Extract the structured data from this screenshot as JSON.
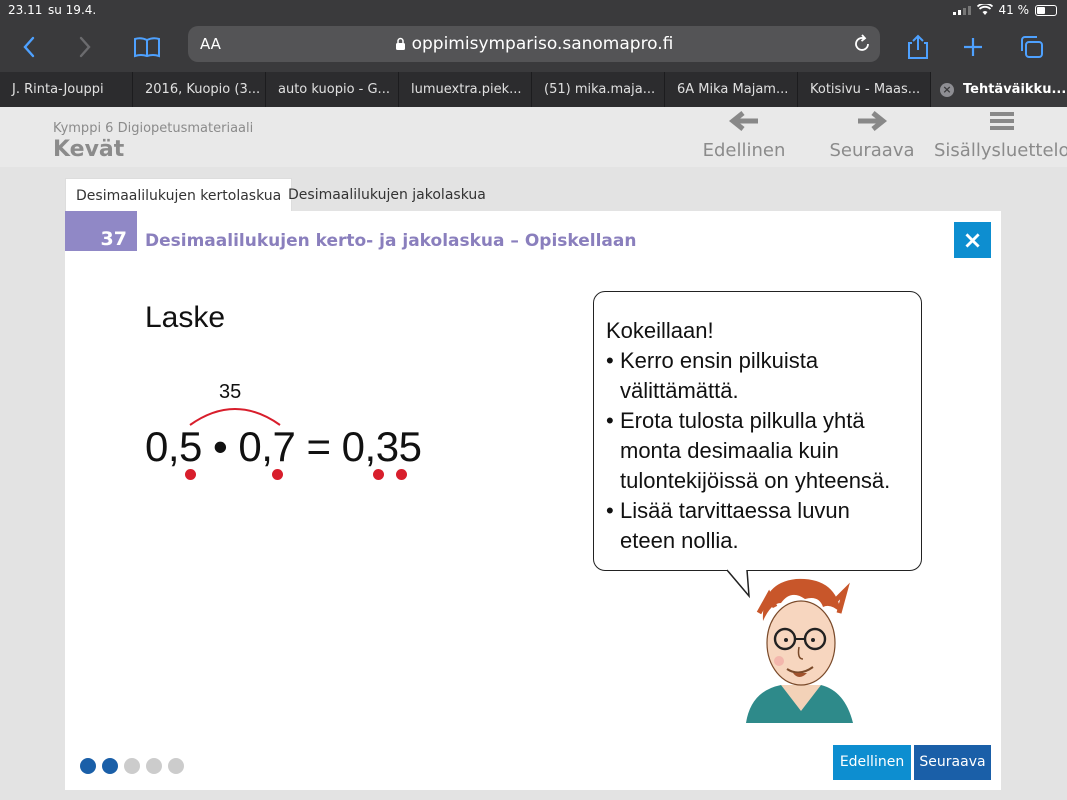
{
  "status": {
    "time": "23.11",
    "date": "su 19.4.",
    "battery": "41 %"
  },
  "browser": {
    "text_size_label": "AA",
    "url": "oppimisympariso.sanomapro.fi",
    "tabs": [
      {
        "label": "J. Rinta-Jouppi"
      },
      {
        "label": "2016, Kuopio (3..."
      },
      {
        "label": "auto kuopio - G..."
      },
      {
        "label": "lumuextra.piek..."
      },
      {
        "label": "(51) mika.maja..."
      },
      {
        "label": "6A Mika Majam..."
      },
      {
        "label": "Kotisivu - Maas..."
      },
      {
        "label": "Tehtäväikku..."
      }
    ]
  },
  "page": {
    "subtitle": "Kymppi 6 Digiopetusmateriaali",
    "title": "Kevät",
    "nav": {
      "prev": "Edellinen",
      "next": "Seuraava",
      "toc": "Sisällysluettelo"
    }
  },
  "content_tabs": [
    "Desimaalilukujen kertolaskua",
    "Desimaalilukujen jakolaskua"
  ],
  "card": {
    "number": "37",
    "title": "Desimaalilukujen kerto- ja jakolaskua – Opiskellaan",
    "close": "×",
    "heading": "Laske",
    "arc_label": "35",
    "equation": "0,5 • 0,7 = 0,35",
    "bubble": {
      "intro": "Kokeillaan!",
      "items": [
        "Kerro ensin pilkuista välittämättä.",
        "Erota tulosta pilkulla yhtä monta desimaalia kuin tulontekijöissä on yhteensä.",
        "Lisää tarvittaessa luvun eteen nollia."
      ]
    },
    "progress": {
      "current": 2,
      "total": 5
    },
    "buttons": {
      "prev": "Edellinen",
      "next": "Seuraava"
    },
    "colors": {
      "badge": "#9088c6",
      "accent_blue": "#0d8ed0",
      "dark_blue": "#1a5fa8",
      "dot_red": "#d81e2c"
    }
  }
}
